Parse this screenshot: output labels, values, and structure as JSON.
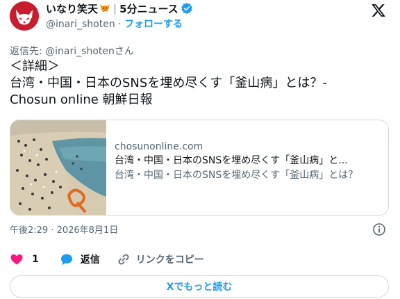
{
  "author": {
    "display_name": "いなり笑天",
    "separator": "|",
    "name_suffix": "5分ニュース",
    "handle": "@inari_shoten",
    "dot": " · ",
    "follow_label": "フォローする"
  },
  "reply_to": "返信先: @inari_shotenさん",
  "tweet_lines": [
    "＜詳細＞",
    "台湾・中国・日本のSNSを埋め尽くす「釜山病」とは？-",
    "Chosun online 朝鮮日報"
  ],
  "link_card": {
    "domain": "chosunonline.com",
    "title": "台湾・中国・日本のSNSを埋め尽くす「釜山病」と...",
    "description": "台湾・中国・日本のSNSを埋め尽くす「釜山病」とは？"
  },
  "timestamp": "午後2:29 · 2026年8月1日",
  "actions": {
    "like_count": "1",
    "reply_label": "返信",
    "copy_link_label": "リンクをコピー"
  },
  "read_more_label": "Xでもっと読む",
  "colors": {
    "accent": "#1d9bf0",
    "like": "#f91880",
    "avatar_bg": "#c81d2c",
    "text_primary": "#0f1419",
    "text_secondary": "#536471",
    "border": "#cfd9de"
  }
}
